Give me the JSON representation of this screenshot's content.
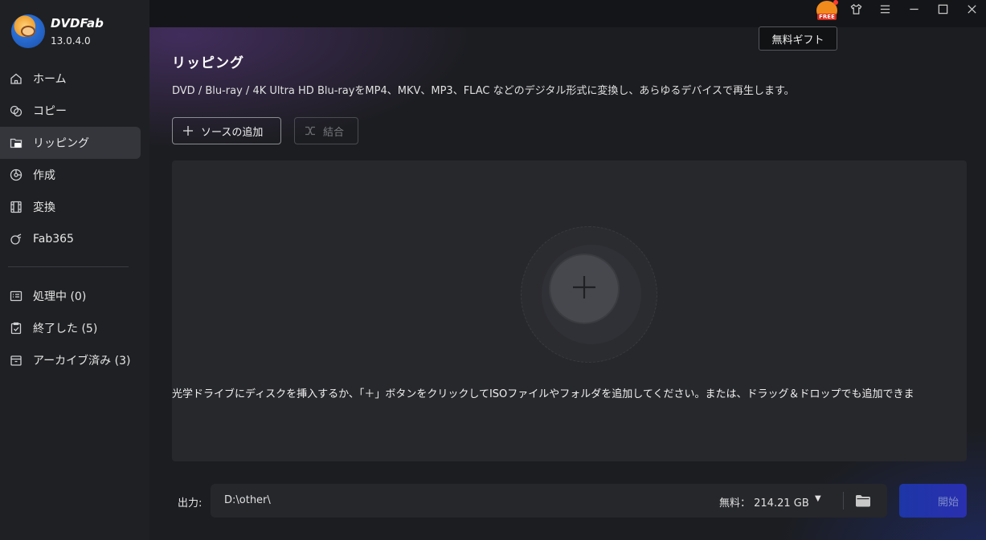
{
  "app": {
    "name": "DVDFab",
    "version": "13.0.4.0"
  },
  "sidebar": {
    "items": [
      {
        "label": "ホーム",
        "icon": "home-icon"
      },
      {
        "label": "コピー",
        "icon": "copy-icon"
      },
      {
        "label": "リッピング",
        "icon": "ripper-icon",
        "active": true
      },
      {
        "label": "作成",
        "icon": "creator-icon"
      },
      {
        "label": "変換",
        "icon": "converter-icon"
      },
      {
        "label": "Fab365",
        "icon": "fab365-icon"
      }
    ],
    "tasks": [
      {
        "label": "処理中 (0)",
        "icon": "processing-icon"
      },
      {
        "label": "終了した (5)",
        "icon": "finished-icon"
      },
      {
        "label": "アーカイブ済み (3)",
        "icon": "archive-icon"
      }
    ]
  },
  "topbar": {
    "free_badge": "FREE",
    "tooltip": "無料ギフト"
  },
  "main": {
    "title": "リッピング",
    "description": "DVD / Blu-ray / 4K Ultra HD Blu-rayをMP4、MKV、MP3、FLAC などのデジタル形式に変換し、あらゆるデバイスで再生します。",
    "add_source_label": "ソースの追加",
    "merge_label": "結合",
    "hint": "光学ドライブにディスクを挿入するか、「＋」ボタンをクリックしてISOファイルやフォルダを追加してください。または、ドラッグ＆ドロップでも追加できま"
  },
  "output": {
    "label": "出力:",
    "path": "D:\\other\\",
    "free_space": "無料：   214.21 GB",
    "start_label": "開始"
  },
  "colors": {
    "accent": "#2a3ab0",
    "sidebar_bg": "#1f2023",
    "active_item": "#34363b"
  }
}
